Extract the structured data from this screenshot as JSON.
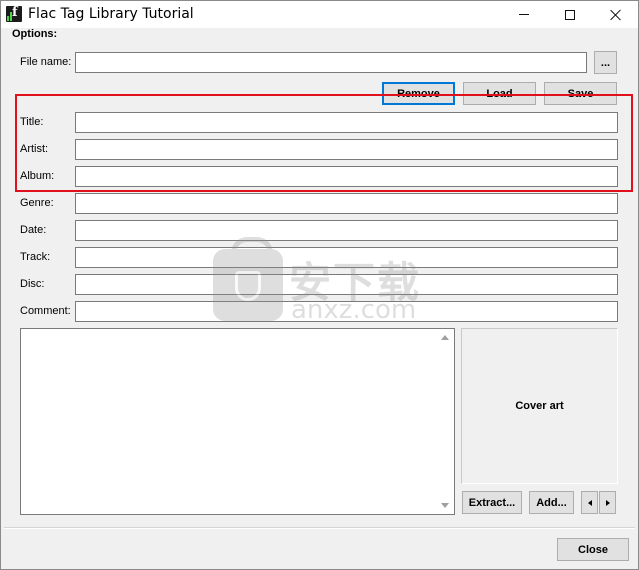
{
  "window": {
    "title": "Flac Tag Library Tutorial"
  },
  "options": {
    "group_label": "Options:",
    "file_name_label": "File name:",
    "file_name_value": "",
    "browse_label": "...",
    "remove_label": "Remove",
    "load_label": "Load",
    "save_label": "Save"
  },
  "fields": [
    {
      "label": "Title:",
      "value": ""
    },
    {
      "label": "Artist:",
      "value": ""
    },
    {
      "label": "Album:",
      "value": ""
    },
    {
      "label": "Genre:",
      "value": ""
    },
    {
      "label": "Date:",
      "value": ""
    },
    {
      "label": "Track:",
      "value": ""
    },
    {
      "label": "Disc:",
      "value": ""
    },
    {
      "label": "Comment:",
      "value": ""
    }
  ],
  "cover": {
    "label": "Cover art",
    "extract_label": "Extract...",
    "add_label": "Add..."
  },
  "footer": {
    "close_label": "Close"
  },
  "watermark": {
    "cn": "安下载",
    "en": "anxz.com"
  },
  "colors": {
    "highlight_box": "#e0111c",
    "default_button_border": "#0078d7",
    "window_bg": "#f0f0f0"
  }
}
